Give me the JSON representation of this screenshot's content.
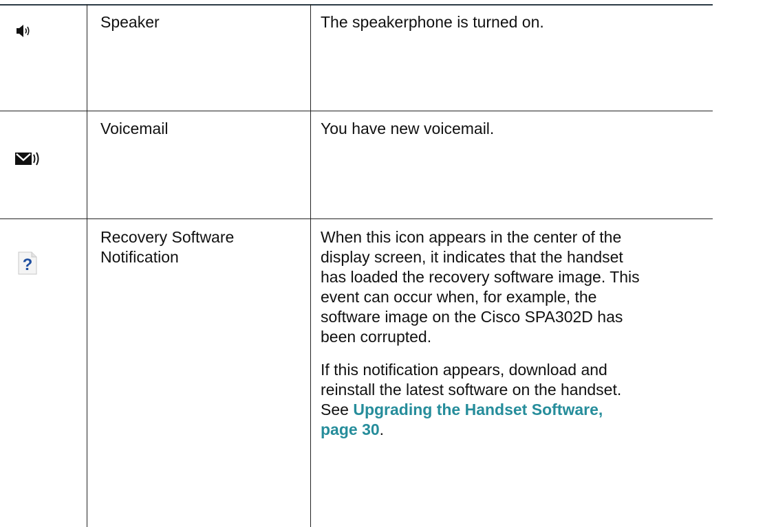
{
  "table": {
    "rows": [
      {
        "icon": "speaker-icon",
        "name": "Speaker",
        "description": [
          "The speakerphone is turned on."
        ]
      },
      {
        "icon": "voicemail-icon",
        "name": "Voicemail",
        "description": [
          "You have new voicemail."
        ]
      },
      {
        "icon": "recovery-question-icon",
        "name_line1": "Recovery Software",
        "name_line2": "Notification",
        "description_lines": [
          "When this icon appears in the center of the",
          "display screen, it indicates that the handset",
          "has loaded the recovery software image. This",
          "event can occur when, for example, the",
          "software image on the Cisco SPA302D has",
          "been corrupted."
        ],
        "description2_lines": [
          "If this notification appears, download and",
          "reinstall the latest software on the handset."
        ],
        "see_prefix": "See ",
        "link_line1": "Upgrading the Handset Software,",
        "link_line2": "page 30",
        "link_suffix": "."
      }
    ]
  },
  "colors": {
    "link": "#268d9b",
    "icon_blue": "#1f4fa0",
    "rule": "#222222"
  }
}
